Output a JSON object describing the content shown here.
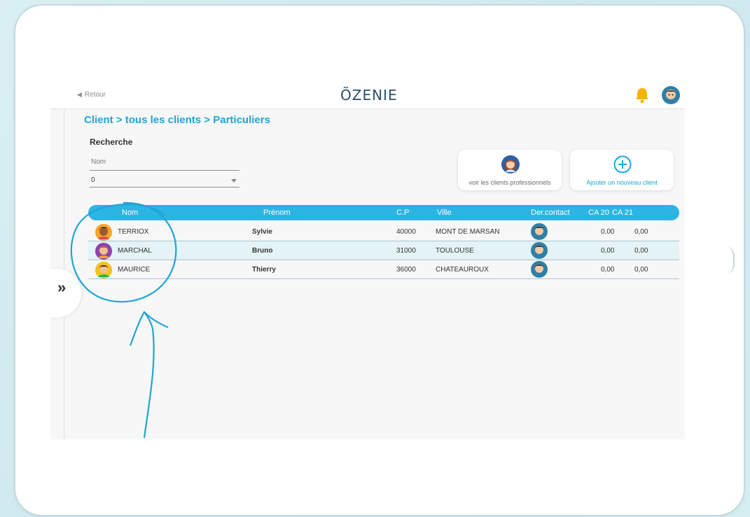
{
  "header": {
    "back_label": "Retour",
    "logo": "ÕZENIE"
  },
  "breadcrumb": "Client > tous les clients > Particuliers",
  "search": {
    "title": "Recherche",
    "name_placeholder": "Nom",
    "select_value": "0"
  },
  "actions": {
    "pro_clients_label": "voir les clients professionnels",
    "new_client_label": "Ajouter un nouveau client"
  },
  "table": {
    "columns": [
      "Nom",
      "Prénom",
      "C.P",
      "Ville",
      "Der.contact",
      "CA 20",
      "CA 21"
    ],
    "rows": [
      {
        "nom": "TERRIOX",
        "prenom": "Sylvie",
        "cp": "40000",
        "ville": "MONT DE MARSAN",
        "ca20": "0,00",
        "ca21": "0,00"
      },
      {
        "nom": "MARCHAL",
        "prenom": "Bruno",
        "cp": "31000",
        "ville": "TOULOUSE",
        "ca20": "0,00",
        "ca21": "0,00"
      },
      {
        "nom": "MAURICE",
        "prenom": "Thierry",
        "cp": "36000",
        "ville": "CHATEAUROUX",
        "ca20": "0,00",
        "ca21": "0,00"
      }
    ]
  },
  "sidebar": {
    "toggle_glyph": "»"
  },
  "colors": {
    "accent": "#1ea6d6",
    "header_bar": "#2cb5e3",
    "row_alt": "#e3f3f6",
    "logo": "#2a4f6f",
    "bell": "#f5b400"
  },
  "icons": [
    "back-triangle-icon",
    "bell-icon",
    "user-avatar-icon",
    "woman-avatar-icon",
    "plus-circle-icon",
    "person-avatar-icon",
    "chevron-double-right-icon"
  ]
}
